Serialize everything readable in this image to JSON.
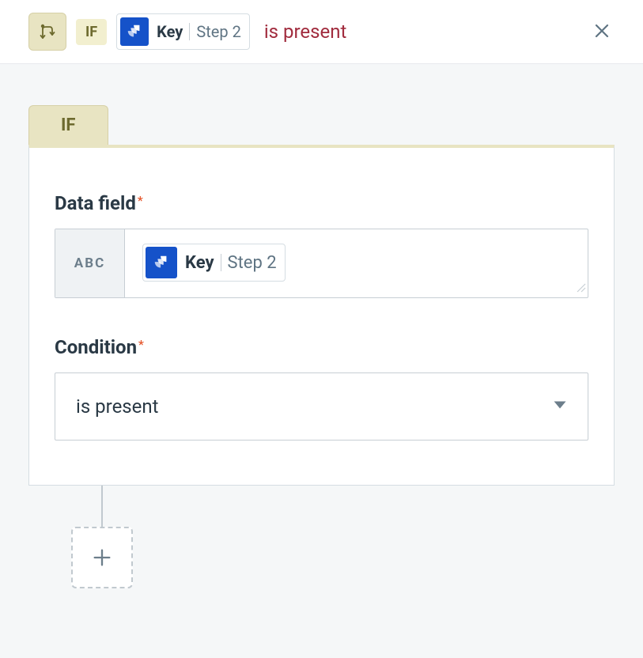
{
  "header": {
    "if_label": "IF",
    "chip_key": "Key",
    "chip_step": "Step 2",
    "condition_text": "is present"
  },
  "tab": {
    "label": "IF"
  },
  "form": {
    "data_field": {
      "label": "Data field",
      "prefix": "ABC",
      "chip_key": "Key",
      "chip_step": "Step 2"
    },
    "condition": {
      "label": "Condition",
      "value": "is present"
    }
  }
}
